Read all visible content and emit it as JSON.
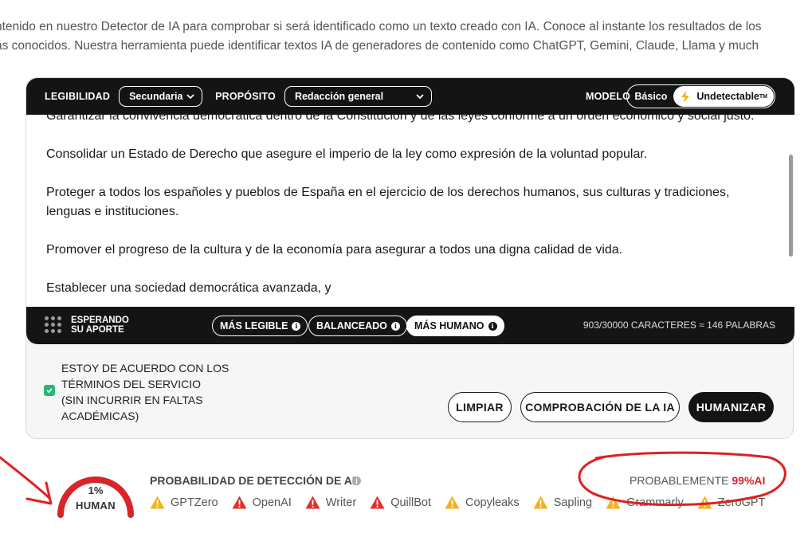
{
  "intro": {
    "line1": "ntenido en nuestro Detector de IA para comprobar si será identificado como un texto creado con IA. Conoce al instante los resultados de los",
    "line2": "ás conocidos. Nuestra herramienta puede identificar textos IA de generadores de contenido como ChatGPT, Gemini, Claude, Llama y much"
  },
  "toolbar": {
    "readability_label": "LEGIBILIDAD",
    "readability_value": "Secundaria",
    "purpose_label": "PROPÓSITO",
    "purpose_value": "Redacción general",
    "model_label": "MODELO",
    "model_basic": "Básico",
    "model_undetectable": "Undetectable",
    "model_tm": "TM"
  },
  "editor": {
    "paragraphs": [
      "Garantizar la convivencia democrática dentro de la Constitución y de las leyes conforme a un orden económico y social justo.",
      "Consolidar un Estado de Derecho que asegure el imperio de la ley como expresión de la voluntad popular.",
      "Proteger a todos los españoles y pueblos de España en el ejercicio de los derechos humanos, sus culturas y tradiciones, lenguas e instituciones.",
      "Promover el progreso de la cultura y de la economía para asegurar a todos una digna calidad de vida.",
      "Establecer una sociedad democrática avanzada, y"
    ]
  },
  "status": {
    "waiting_line1": "ESPERANDO",
    "waiting_line2": "SU APORTE",
    "modes": [
      "MÁS LEGIBLE",
      "BALANCEADO",
      "MÁS HUMANO"
    ],
    "active_mode": "MÁS HUMANO",
    "count": "903/30000 CARACTERES ≈ 146 PALABRAS"
  },
  "terms": {
    "checked": true,
    "line1": "ESTOY DE ACUERDO CON LOS",
    "line2": "TÉRMINOS DEL SERVICIO",
    "line3": "(SIN INCURRIR EN FALTAS",
    "line4": "ACADÉMICAS)"
  },
  "actions": {
    "clear": "LIMPIAR",
    "check": "COMPROBACIÓN DE LA IA",
    "humanize": "HUMANIZAR"
  },
  "detection": {
    "human_percent": "1%",
    "human_label": "HUMAN",
    "title": "PROBABILIDAD DE DETECCIÓN DE AI",
    "verdict_prefix": "PROBABLEMENTE",
    "verdict_value": "99%AI",
    "detectors": [
      {
        "name": "GPTZero",
        "status": "warning-yellow"
      },
      {
        "name": "OpenAI",
        "status": "warning-red"
      },
      {
        "name": "Writer",
        "status": "warning-red"
      },
      {
        "name": "QuillBot",
        "status": "warning-red"
      },
      {
        "name": "Copyleaks",
        "status": "warning-yellow"
      },
      {
        "name": "Sapling",
        "status": "warning-yellow"
      },
      {
        "name": "Grammarly",
        "status": "warning-yellow"
      },
      {
        "name": "ZeroGPT",
        "status": "warning-yellow"
      }
    ]
  },
  "colors": {
    "dark": "#141414",
    "accent_green": "#2bb673",
    "danger": "#d6262a",
    "warning_yellow": "#f2b21b",
    "warning_red": "#e0312c",
    "annotation_red": "#e02020"
  }
}
